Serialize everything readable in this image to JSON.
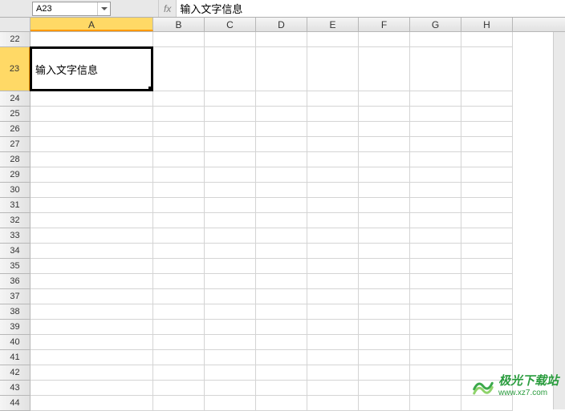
{
  "formula_bar": {
    "cell_ref": "A23",
    "fx_label": "fx",
    "formula_text": "输入文字信息"
  },
  "columns": [
    "A",
    "B",
    "C",
    "D",
    "E",
    "F",
    "G",
    "H"
  ],
  "active_column": "A",
  "rows": [
    22,
    23,
    24,
    25,
    26,
    27,
    28,
    29,
    30,
    31,
    32,
    33,
    34,
    35,
    36,
    37,
    38,
    39,
    40,
    41,
    42,
    43,
    44
  ],
  "active_row": 23,
  "tall_row": 23,
  "cells": {
    "A23": "输入文字信息"
  },
  "watermark": {
    "title": "极光下载站",
    "url": "www.xz7.com"
  }
}
